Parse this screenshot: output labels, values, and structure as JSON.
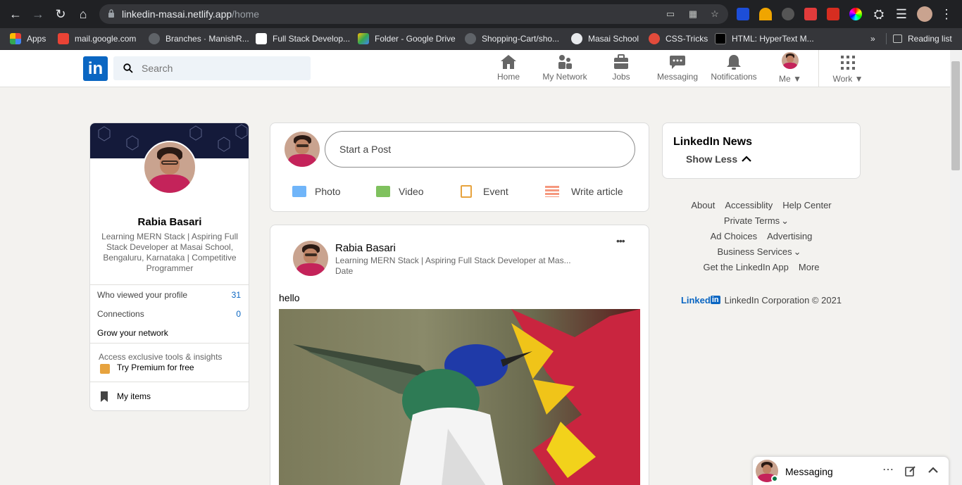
{
  "browser": {
    "url_host": "linkedin-masai.netlify.app",
    "url_path": "/home",
    "bookmarks": [
      {
        "label": "Apps",
        "color": "#ea4335"
      },
      {
        "label": "mail.google.com",
        "color": "#ea4335"
      },
      {
        "label": "Branches · ManishR...",
        "color": "#444"
      },
      {
        "label": "Full Stack Develop...",
        "color": "#fff"
      },
      {
        "label": "Folder - Google Drive",
        "color": "#fbbc04"
      },
      {
        "label": "Shopping-Cart/sho...",
        "color": "#444"
      },
      {
        "label": "Masai School",
        "color": "#ddd"
      },
      {
        "label": "CSS-Tricks",
        "color": "#e24b3b"
      },
      {
        "label": "HTML: HyperText M...",
        "color": "#000"
      }
    ],
    "more_bookmarks": "»",
    "reading_list": "Reading list"
  },
  "header": {
    "logo": "in",
    "search_placeholder": "Search",
    "nav": [
      {
        "label": "Home"
      },
      {
        "label": "My Network"
      },
      {
        "label": "Jobs"
      },
      {
        "label": "Messaging"
      },
      {
        "label": "Notifications"
      },
      {
        "label": "Me"
      },
      {
        "label": "Work"
      }
    ]
  },
  "profile": {
    "name": "Rabia Basari",
    "headline_lines": [
      "Learning MERN Stack | Aspiring Full",
      "Stack Developer at Masai School,",
      "Bengaluru, Karnataka | Competitive",
      "Programmer"
    ],
    "stats": [
      {
        "label": "Who viewed your profile",
        "value": "31"
      },
      {
        "label": "Connections",
        "value": "0"
      }
    ],
    "grow": "Grow your network",
    "premium_prompt": "Access exclusive tools & insights",
    "premium_cta": "Try Premium for free",
    "my_items": "My items"
  },
  "composer": {
    "placeholder": "Start a Post",
    "actions": [
      {
        "label": "Photo",
        "color": "#70b5f9"
      },
      {
        "label": "Video",
        "color": "#7fc15e"
      },
      {
        "label": "Event",
        "color": "#e7a33e"
      },
      {
        "label": "Write article",
        "color": "#f5987e"
      }
    ]
  },
  "post": {
    "author": "Rabia Basari",
    "subtitle": "Learning MERN Stack | Aspiring Full Stack Developer at Mas...",
    "date": "Date",
    "text": "hello",
    "menu": "•••"
  },
  "news": {
    "title": "LinkedIn News",
    "toggle": "Show Less"
  },
  "footer": {
    "rows": [
      [
        "About",
        "Accessiblity",
        "Help Center"
      ],
      [
        "Private Terms"
      ],
      [
        "Ad Choices",
        "Advertising"
      ],
      [
        "Business Services"
      ],
      [
        "Get the LinkedIn App",
        "More"
      ]
    ],
    "brand": "Linked",
    "brand_in": "in",
    "copyright": "LinkedIn Corporation © 2021"
  },
  "messaging": {
    "label": "Messaging"
  }
}
